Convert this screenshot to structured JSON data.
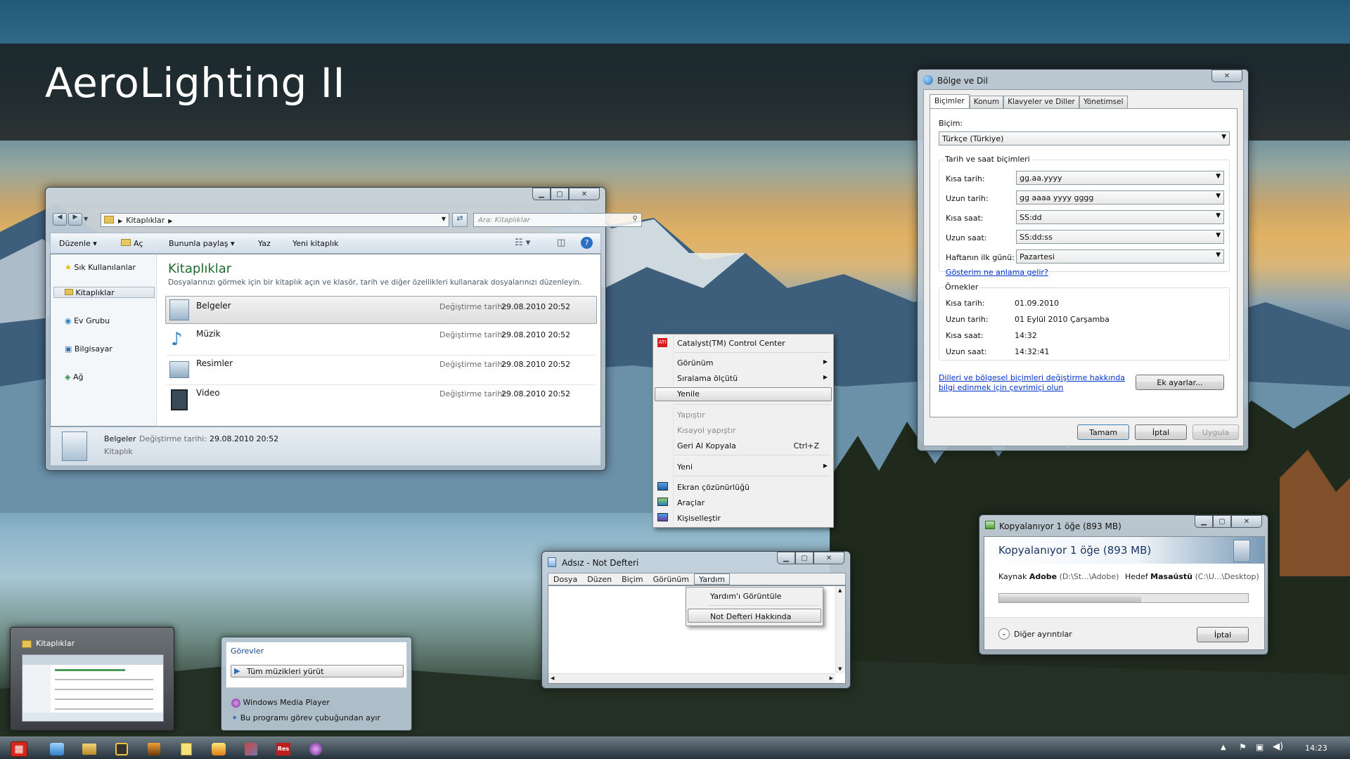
{
  "banner": {
    "title": "AeroLighting II"
  },
  "explorer": {
    "address": "Kitaplıklar",
    "search_placeholder": "Ara: Kitaplıklar",
    "toolbar": {
      "organize": "Düzenle",
      "open": "Aç",
      "share": "Bununla paylaş",
      "burn": "Yaz",
      "new_library": "Yeni kitaplık"
    },
    "nav": [
      {
        "label": "Sık Kullanılanlar"
      },
      {
        "label": "Kitaplıklar"
      },
      {
        "label": "Ev Grubu"
      },
      {
        "label": "Bilgisayar"
      },
      {
        "label": "Ağ"
      }
    ],
    "heading": "Kitaplıklar",
    "subtitle": "Dosyalarınızı görmek için bir kitaplık açın ve klasör, tarih ve diğer özellikleri kullanarak dosyalarınızı düzenleyin.",
    "items": [
      {
        "name": "Belgeler",
        "date_label": "Değiştirme tarihi:",
        "date": "29.08.2010 20:52"
      },
      {
        "name": "Müzik",
        "date_label": "Değiştirme tarihi:",
        "date": "29.08.2010 20:52"
      },
      {
        "name": "Resimler",
        "date_label": "Değiştirme tarihi:",
        "date": "29.08.2010 20:52"
      },
      {
        "name": "Video",
        "date_label": "Değiştirme tarihi:",
        "date": "29.08.2010 20:52"
      }
    ],
    "details": {
      "name": "Belgeler",
      "date_label": "Değiştirme tarihi:",
      "date": "29.08.2010 20:52",
      "type": "Kitaplık"
    }
  },
  "context_menu": {
    "items": [
      "Catalyst(TM) Control Center",
      "Görünüm",
      "Sıralama ölçütü",
      "Yenile",
      "Yapıştır",
      "Kısayol yapıştır",
      "Geri Al Kopyala",
      "Yeni",
      "Ekran çözünürlüğü",
      "Araçlar",
      "Kişiselleştir"
    ],
    "undo_shortcut": "Ctrl+Z"
  },
  "region": {
    "title": "Bölge ve Dil",
    "tabs": [
      "Biçimler",
      "Konum",
      "Klavyeler ve Diller",
      "Yönetimsel"
    ],
    "format_label": "Biçim:",
    "format_value": "Türkçe (Türkiye)",
    "dt_group": "Tarih ve saat biçimleri",
    "fields": [
      {
        "label": "Kısa tarih:",
        "value": "gg.aa.yyyy"
      },
      {
        "label": "Uzun tarih:",
        "value": "gg aaaa yyyy gggg"
      },
      {
        "label": "Kısa saat:",
        "value": "SS:dd"
      },
      {
        "label": "Uzun saat:",
        "value": "SS:dd:ss"
      },
      {
        "label": "Haftanın ilk günü:",
        "value": "Pazartesi"
      }
    ],
    "notation_link": "Gösterim ne anlama gelir?",
    "examples_group": "Örnekler",
    "examples": [
      {
        "label": "Kısa tarih:",
        "value": "01.09.2010"
      },
      {
        "label": "Uzun tarih:",
        "value": "01 Eylül 2010 Çarşamba"
      },
      {
        "label": "Kısa saat:",
        "value": "14:32"
      },
      {
        "label": "Uzun saat:",
        "value": "14:32:41"
      }
    ],
    "online_link_1": "Dilleri ve bölgesel biçimleri değiştirme hakkında",
    "online_link_2": "bilgi edinmek için çevrimiçi olun",
    "extra_button": "Ek ayarlar...",
    "ok": "Tamam",
    "cancel": "İptal",
    "apply": "Uygula"
  },
  "copy": {
    "title": "Kopyalanıyor 1 öğe (893 MB)",
    "heading": "Kopyalanıyor 1 öğe (893 MB)",
    "source_label": "Kaynak",
    "source_name": "Adobe",
    "source_path": "(D:\\St...\\Adobe)",
    "dest_label": "Hedef",
    "dest_name": "Masaüstü",
    "dest_path": "(C:\\U...\\Desktop)",
    "progress": 0.57,
    "more": "Diğer ayrıntılar",
    "cancel": "İptal"
  },
  "notepad": {
    "title": "Adsız - Not Defteri",
    "menus": [
      "Dosya",
      "Düzen",
      "Biçim",
      "Görünüm",
      "Yardım"
    ],
    "help_items": [
      "Yardım'ı Görüntüle",
      "Not Defteri Hakkında"
    ]
  },
  "thumbnail": {
    "title": "Kitaplıklar"
  },
  "jumplist": {
    "section": "Görevler",
    "task": "Tüm müzikleri yürüt",
    "app": "Windows Media Player",
    "unpin": "Bu programı görev çubuğundan ayır"
  },
  "taskbar": {
    "clock": "14:23"
  }
}
